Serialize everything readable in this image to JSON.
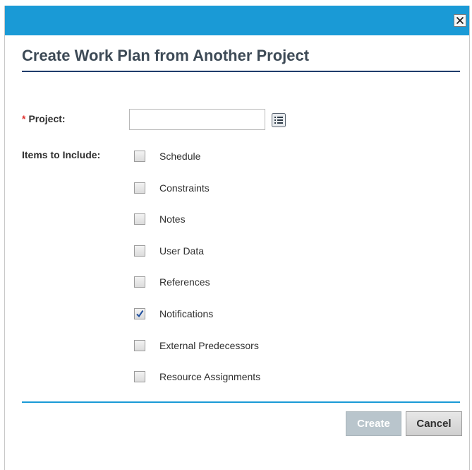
{
  "dialog": {
    "title": "Create Work Plan from Another Project",
    "close_label": "Close",
    "colors": {
      "titlebar": "#1a9ad6",
      "heading_rule": "#1f3d6b",
      "footer_rule": "#1a9ad6",
      "required": "#e0312e"
    }
  },
  "form": {
    "required_marker": "*",
    "project_label": "Project:",
    "project_value": "",
    "project_placeholder": "",
    "lookup_icon": "list-lookup-icon",
    "items_label": "Items to Include:",
    "items": [
      {
        "label": "Schedule",
        "checked": false
      },
      {
        "label": "Constraints",
        "checked": false
      },
      {
        "label": "Notes",
        "checked": false
      },
      {
        "label": "User Data",
        "checked": false
      },
      {
        "label": "References",
        "checked": false
      },
      {
        "label": "Notifications",
        "checked": true
      },
      {
        "label": "External Predecessors",
        "checked": false
      },
      {
        "label": "Resource Assignments",
        "checked": false
      }
    ]
  },
  "footer": {
    "create_label": "Create",
    "create_enabled": false,
    "cancel_label": "Cancel"
  }
}
